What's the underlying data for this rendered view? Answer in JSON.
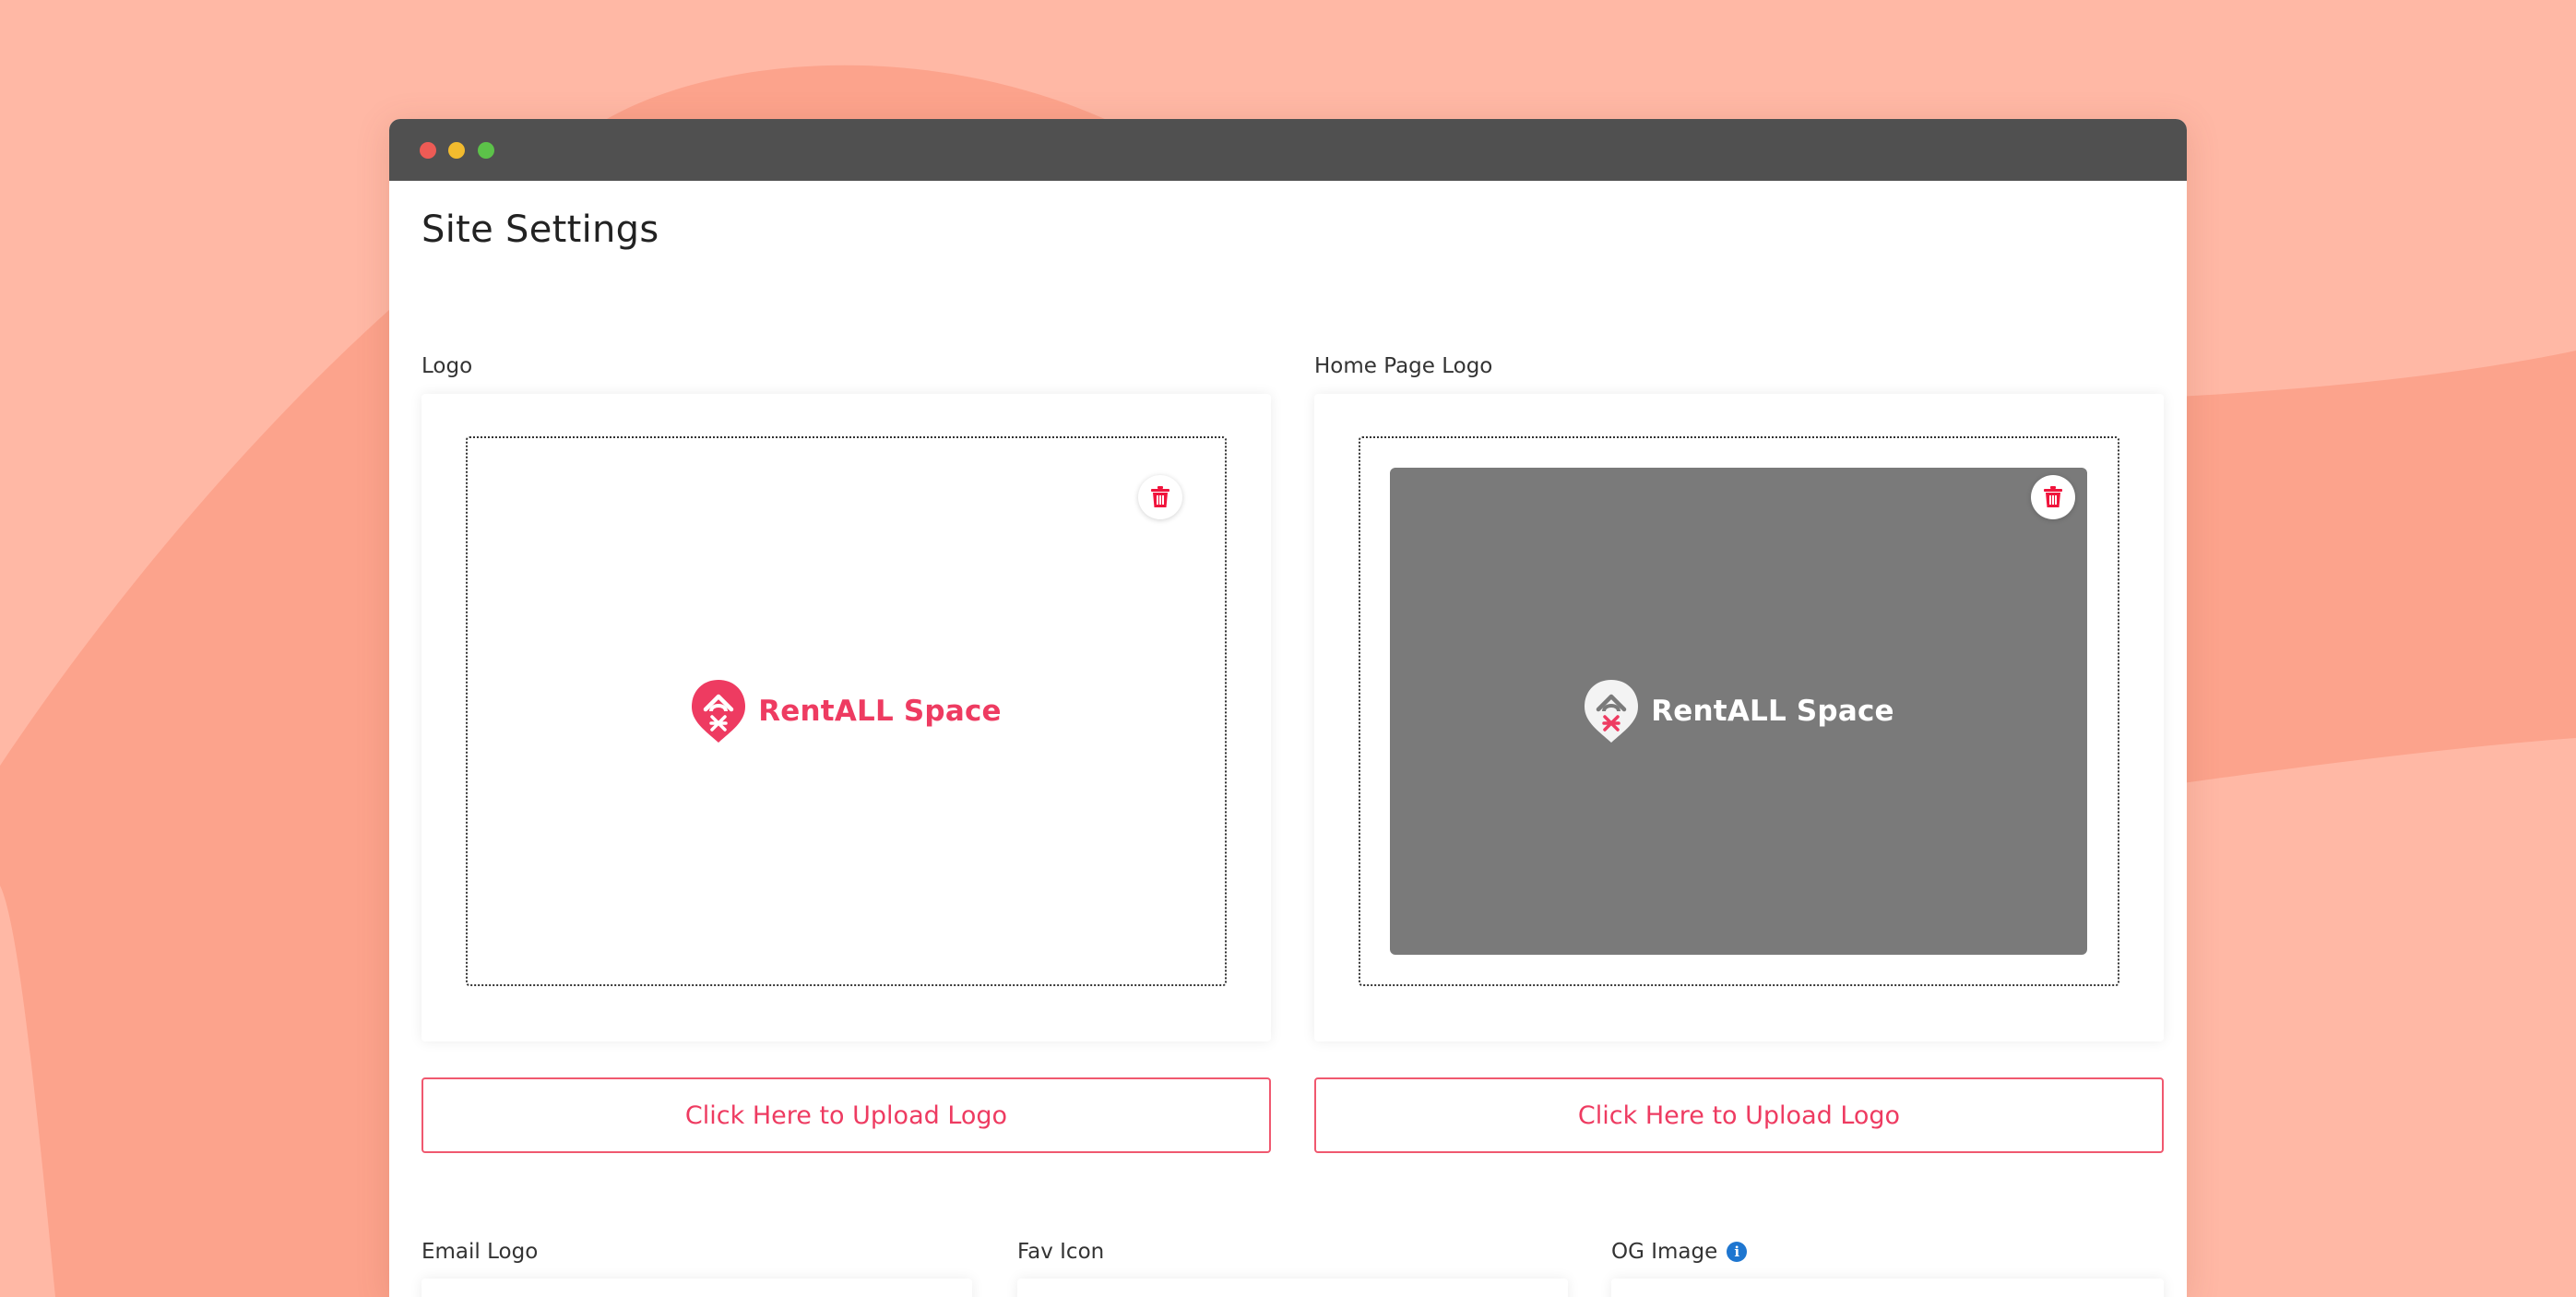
{
  "page": {
    "title": "Site Settings"
  },
  "fields": {
    "logo": {
      "label": "Logo",
      "logo_text": "RentALL Space",
      "upload_label": "Click Here to Upload Logo"
    },
    "home_page_logo": {
      "label": "Home Page Logo",
      "logo_text": "RentALL Space",
      "upload_label": "Click Here to Upload Logo"
    },
    "email_logo": {
      "label": "Email Logo"
    },
    "fav_icon": {
      "label": "Fav Icon"
    },
    "og_image": {
      "label": "OG Image",
      "info_icon": "i"
    }
  },
  "icons": {
    "window_controls": [
      "close-dot",
      "minimize-dot",
      "maximize-dot"
    ],
    "delete": "trash-icon",
    "info": "info-icon",
    "brand": "location-pin-logo-icon"
  },
  "colors": {
    "accent": "#EE3B61",
    "delete_icon": "#F0143C",
    "info_icon": "#1E76D0",
    "titlebar": "#505050",
    "background": "#FFB8A5",
    "dark_preview": "#7A7A7A"
  }
}
